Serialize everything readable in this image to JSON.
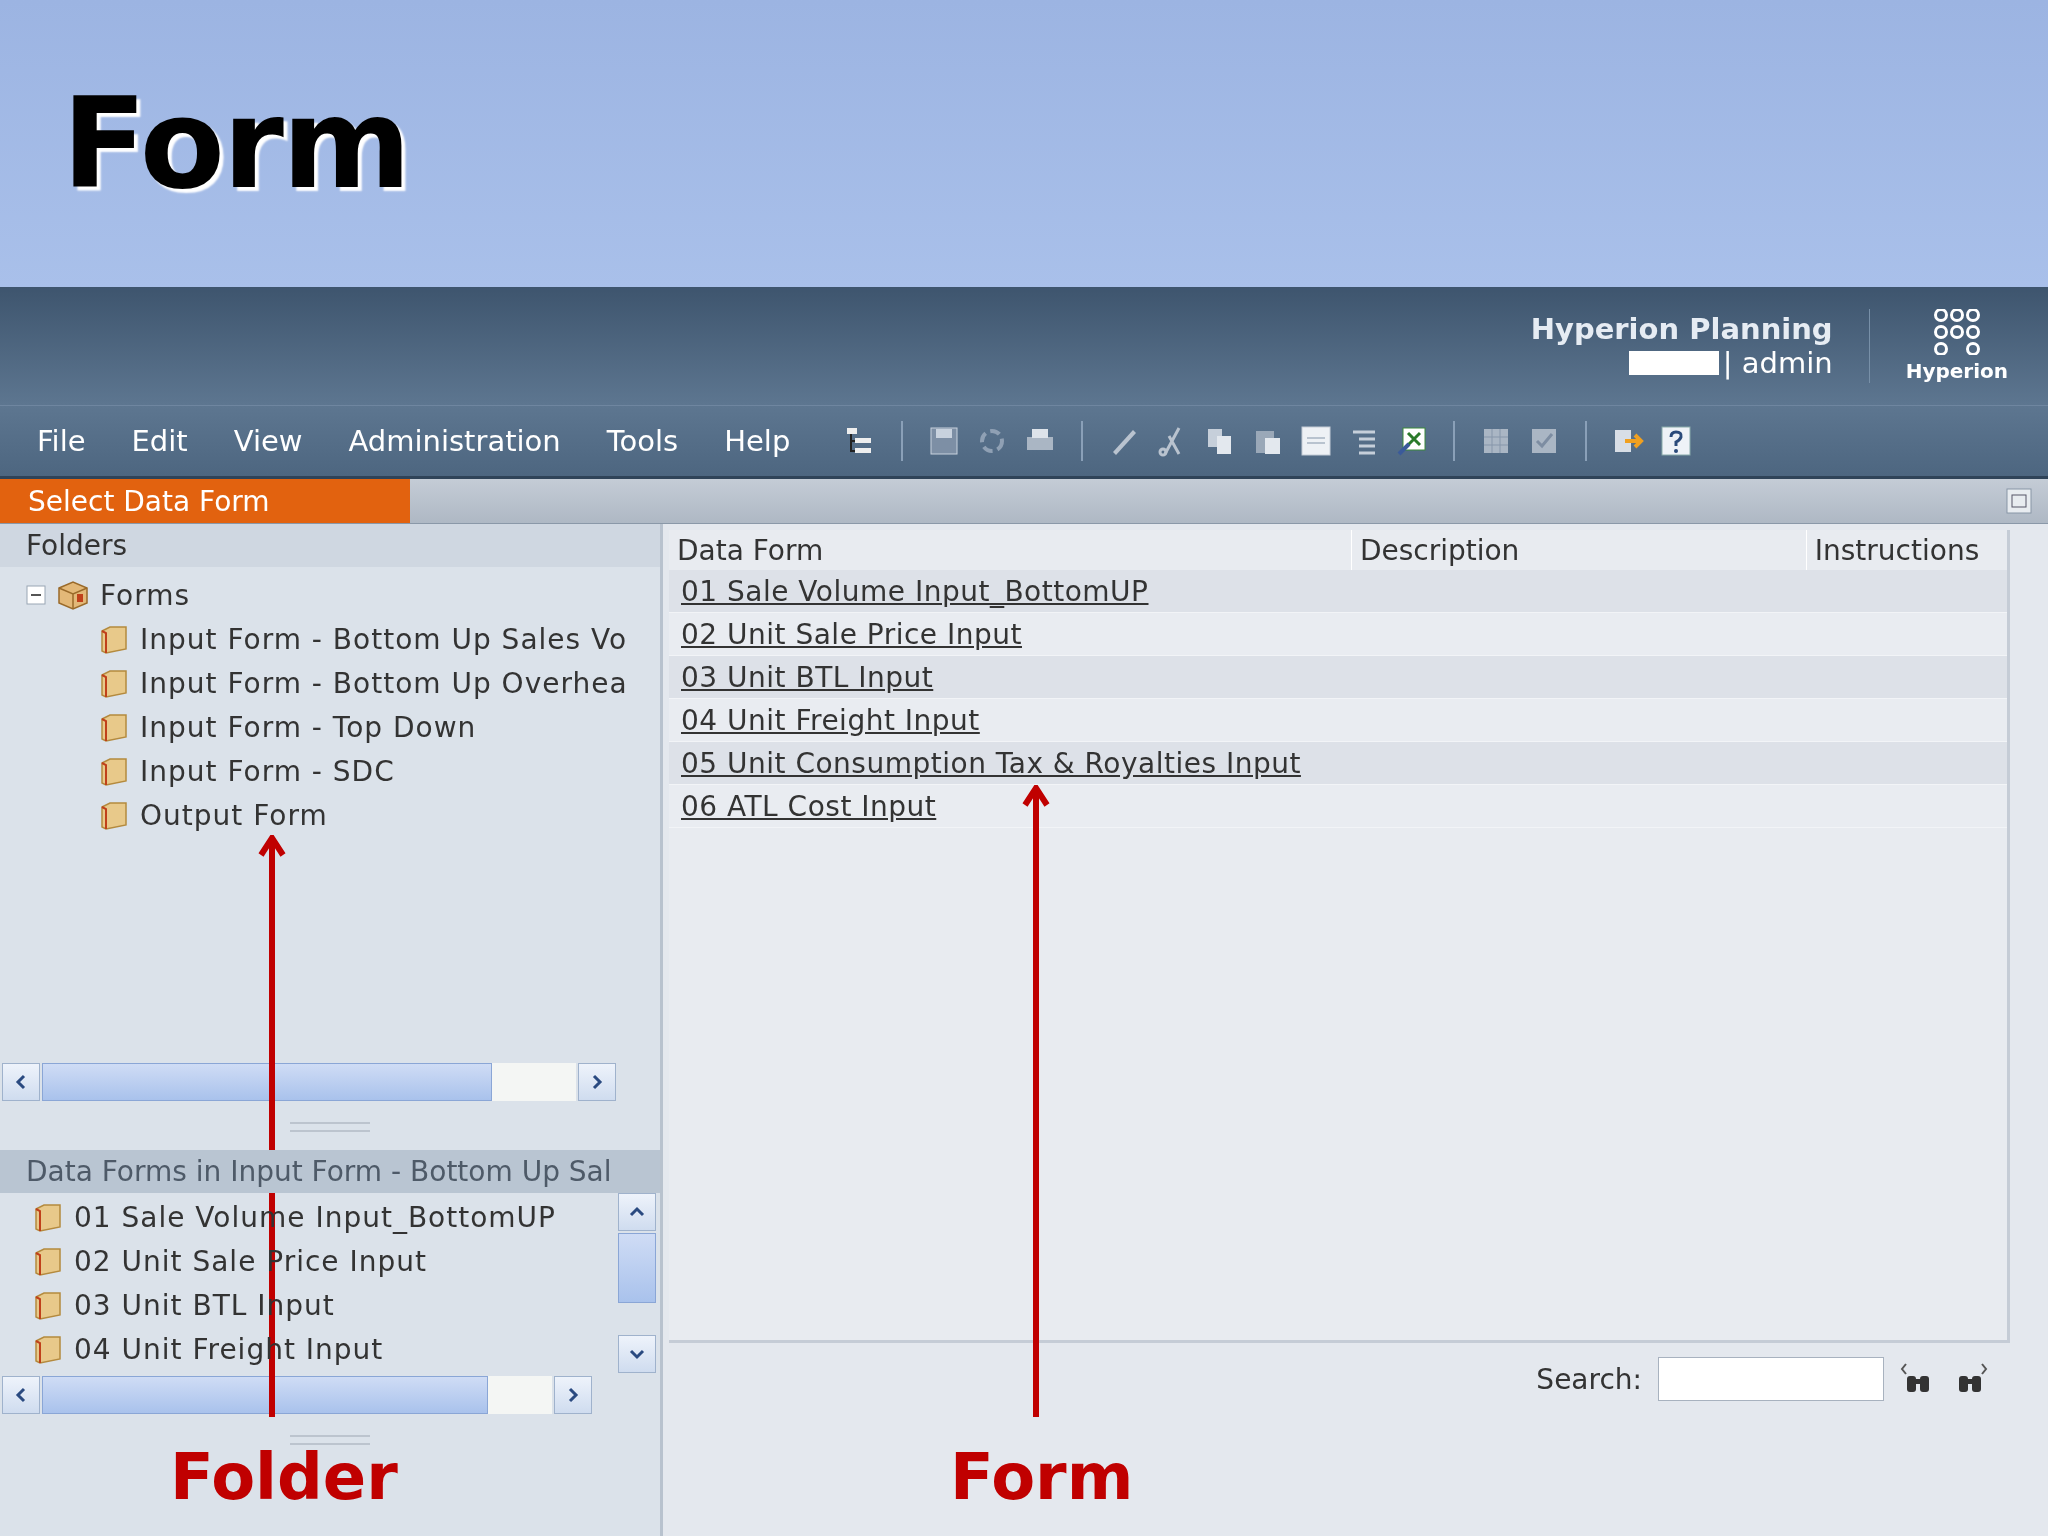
{
  "slide": {
    "title": "Form"
  },
  "app_header": {
    "product": "Hyperion Planning",
    "user": "| admin",
    "logo_text": "Hyperion"
  },
  "menu": [
    "File",
    "Edit",
    "View",
    "Administration",
    "Tools",
    "Help"
  ],
  "panel": {
    "title": "Select Data Form"
  },
  "folders": {
    "header": "Folders",
    "tree": [
      {
        "label": "Forms",
        "expanded": true,
        "children": [
          {
            "label": "Input Form - Bottom Up Sales Vo"
          },
          {
            "label": "Input Form - Bottom Up Overhea"
          },
          {
            "label": "Input Form - Top Down"
          },
          {
            "label": "Input Form - SDC"
          },
          {
            "label": "Output Form"
          }
        ]
      }
    ]
  },
  "folder_forms": {
    "header": "Data Forms in Input Form - Bottom Up Sal",
    "items": [
      "01 Sale Volume Input_BottomUP",
      "02 Unit Sale Price Input",
      "03 Unit BTL Input",
      "04 Unit Freight Input"
    ]
  },
  "table": {
    "columns": [
      "Data Form",
      "Description",
      "Instructions"
    ],
    "rows": [
      {
        "data_form": "01 Sale Volume Input_BottomUP"
      },
      {
        "data_form": "02 Unit Sale Price Input"
      },
      {
        "data_form": "03 Unit BTL Input"
      },
      {
        "data_form": "04 Unit Freight Input"
      },
      {
        "data_form": "05 Unit Consumption Tax & Royalties Input"
      },
      {
        "data_form": "06 ATL Cost Input"
      }
    ]
  },
  "search": {
    "label": "Search:"
  },
  "annotations": [
    {
      "label": "Folder"
    },
    {
      "label": "Form"
    }
  ]
}
